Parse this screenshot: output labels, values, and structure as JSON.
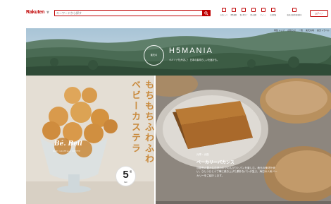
{
  "header": {
    "logo": "Rakuten",
    "search_placeholder": "キーワードから探す",
    "nav": [
      {
        "label": "お気に入り"
      },
      {
        "label": "閲覧履歴"
      },
      {
        "label": "買い物かご"
      },
      {
        "label": "購入履歴"
      },
      {
        "label": "ポイント"
      },
      {
        "label": "会員情報"
      }
    ],
    "nav_wide": "楽天会員登録(無料)",
    "login": "ログイン"
  },
  "hero": {
    "links": [
      "特集トップ",
      "お知らせ",
      "一覧",
      "楽天市場",
      "楽天トラベル"
    ],
    "emblem": "楽天の",
    "title": "H5MANIA",
    "subtitle": "ペルソナを大切に！ 日本の素晴らしいを届ける。"
  },
  "left_panel": {
    "vertical_text": "もちもちふわふわベビーカステラ",
    "brand": "Bé. Bell",
    "brand_sub": "BABY CASTELLA COFFEE",
    "badge_number": "5",
    "badge_unit": "個",
    "badge_sub": "Bell"
  },
  "right_panel": {
    "category": "兵庫・淡路",
    "title": "ベーカリーバカンス",
    "description": "淡路島の豊かな自然の中でのんびりとパンを楽しむ。地元の食材を使い、ひとつひとつ丁寧に焼き上げた素朴なパンが並ぶ、海辺の人気ベーカリーをご紹介します。"
  }
}
